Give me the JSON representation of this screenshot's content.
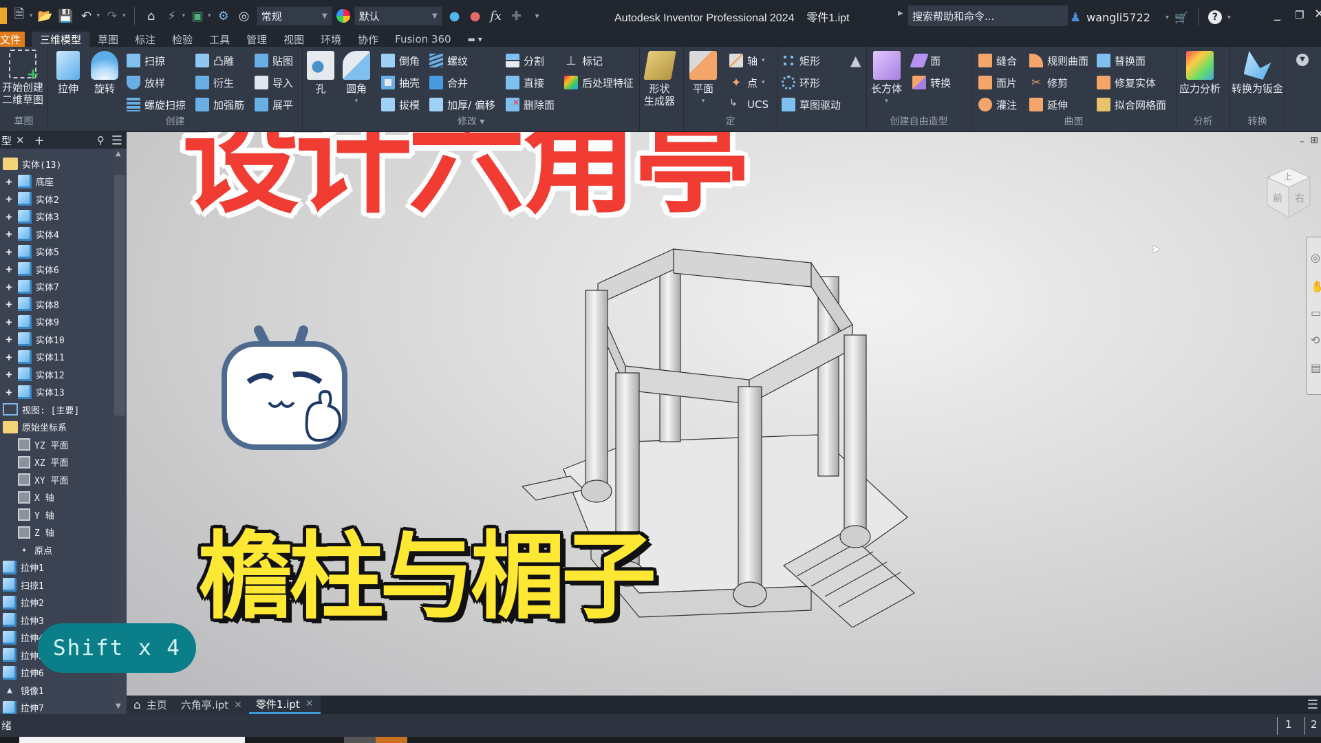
{
  "titlebar": {
    "app_title": "Autodesk Inventor Professional 2024",
    "doc_title": "零件1.ipt",
    "appearance_combo": "常规",
    "material_combo": "默认",
    "search_placeholder": "搜索帮助和命令...",
    "username": "wangli5722",
    "fx_label": "fx"
  },
  "menu_tabs": [
    {
      "label": "文件",
      "kind": "file"
    },
    {
      "label": "三维模型",
      "active": true
    },
    {
      "label": "草图"
    },
    {
      "label": "标注"
    },
    {
      "label": "检验"
    },
    {
      "label": "工具"
    },
    {
      "label": "管理"
    },
    {
      "label": "视图"
    },
    {
      "label": "环境"
    },
    {
      "label": "协作"
    },
    {
      "label": "Fusion 360"
    }
  ],
  "ribbon": {
    "panels": {
      "sketch": "草图",
      "create": "创建",
      "modify": "修改",
      "work_features": "定",
      "pattern": "",
      "freeform": "创建自由造型",
      "surface": "曲面",
      "analysis": "分析",
      "convert": "转换"
    },
    "start_sketch_1": "开始创建",
    "start_sketch_2": "二维草图",
    "extrude": "拉伸",
    "revolve": "旋转",
    "sweep": "扫掠",
    "loft": "放样",
    "coil": "螺旋扫掠",
    "emboss": "凸雕",
    "derive": "衍生",
    "rib": "加强筋",
    "decal": "贴图",
    "import": "导入",
    "unwrap": "展平",
    "hole": "孔",
    "fillet": "圆角",
    "chamfer": "倒角",
    "shell": "抽壳",
    "draft": "拔模",
    "thread": "螺纹",
    "combine": "合并",
    "thicken": "加厚/ 偏移",
    "split": "分割",
    "direct": "直接",
    "delete_face": "删除面",
    "mark": "标记",
    "post_process": "后处理特征",
    "shape_gen_1": "形状",
    "shape_gen_2": "生成器",
    "plane": "平面",
    "axis": "轴",
    "point": "点",
    "ucs": "UCS",
    "rect": "矩形",
    "circular": "环形",
    "sketch_driven": "草图驱动",
    "box": "长方体",
    "face": "面",
    "convert": "转换",
    "stitch": "缝合",
    "patch": "面片",
    "sculpt": "灌注",
    "ruled": "规则曲面",
    "trim": "修剪",
    "extend": "延伸",
    "replace_face": "替换面",
    "repair": "修复实体",
    "fit_mesh": "拟合网格面",
    "stress": "应力分析",
    "to_sheetmetal": "转换为钣金"
  },
  "browser": {
    "tab_label": "型",
    "root": "实体(13)",
    "solids": [
      "底座",
      "实体2",
      "实体3",
      "实体4",
      "实体5",
      "实体6",
      "实体7",
      "实体8",
      "实体9",
      "实体10",
      "实体11",
      "实体12",
      "实体13"
    ],
    "view": "视图: [主要]",
    "origin": "原始坐标系",
    "origin_items": [
      "YZ 平面",
      "XZ 平面",
      "XY 平面",
      "X 轴",
      "Y 轴",
      "Z 轴",
      "原点"
    ],
    "features": [
      "拉伸1",
      "扫掠1",
      "拉伸2",
      "拉伸3",
      "拉伸4",
      "拉伸5",
      "拉伸6",
      "镜像1",
      "拉伸7"
    ]
  },
  "viewcube": {
    "top": "上",
    "front": "前",
    "right": "右"
  },
  "doc_tabs": [
    {
      "label": "主页",
      "icon": "home-icon"
    },
    {
      "label": "六角亭.ipt",
      "closable": true
    },
    {
      "label": "零件1.ipt",
      "closable": true,
      "active": true
    }
  ],
  "status": {
    "text": "绪",
    "count1": "1",
    "count2": "2"
  },
  "overlay": {
    "title": "设计六角亭",
    "subtitle": "檐柱与楣子",
    "keystroke": "Shift x 4"
  },
  "colors": {
    "accent_file_tab": "#e07b1c",
    "title_red": "#f03c33",
    "subtitle_yellow": "#ffe833",
    "keystroke_bg": "#0b7f89",
    "active_tab_underline": "#3a9ad9"
  }
}
